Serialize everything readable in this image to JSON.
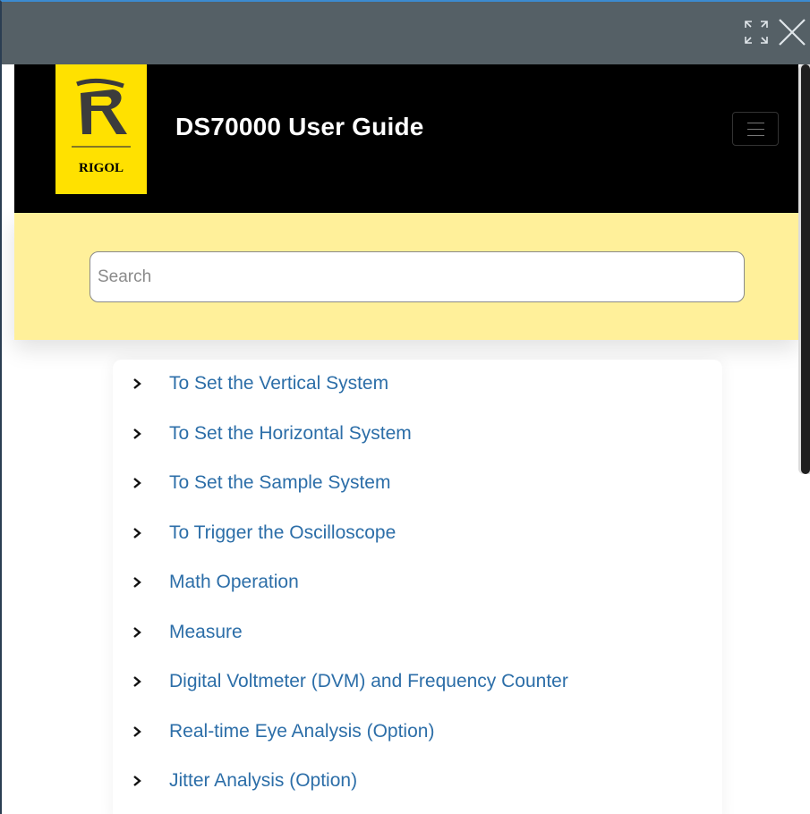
{
  "window": {
    "expand_icon": "expand-arrows-icon",
    "close_icon": "close-x-icon"
  },
  "header": {
    "logo_text": "RIGOL",
    "title": "DS70000 User Guide",
    "menu_icon": "hamburger-menu-icon",
    "colors": {
      "logo_bg": "#ffe100",
      "header_bg": "#000000",
      "title": "#ffffff"
    }
  },
  "search": {
    "placeholder": "Search",
    "value": "",
    "band_color": "#fff09a"
  },
  "toc": {
    "link_color": "#2c6ea8",
    "items": [
      {
        "label": "To Set the Vertical System"
      },
      {
        "label": "To Set the Horizontal System"
      },
      {
        "label": "To Set the Sample System"
      },
      {
        "label": "To Trigger the Oscilloscope"
      },
      {
        "label": "Math Operation"
      },
      {
        "label": "Measure"
      },
      {
        "label": "Digital Voltmeter (DVM) and Frequency Counter"
      },
      {
        "label": "Real-time Eye Analysis (Option)"
      },
      {
        "label": "Jitter Analysis (Option)"
      }
    ]
  }
}
